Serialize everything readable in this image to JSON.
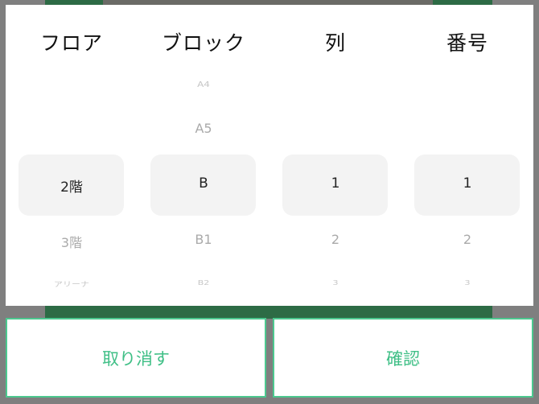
{
  "picker": {
    "columns": [
      {
        "header": "フロア",
        "above_far": "",
        "above_near": "",
        "selected": "2階",
        "below_near": "3階",
        "below_far": "アリーナ"
      },
      {
        "header": "ブロック",
        "above_far": "A4",
        "above_near": "A5",
        "selected": "B",
        "below_near": "B1",
        "below_far": "B2"
      },
      {
        "header": "列",
        "above_far": "",
        "above_near": "",
        "selected": "1",
        "below_near": "2",
        "below_far": "3"
      },
      {
        "header": "番号",
        "above_far": "",
        "above_near": "",
        "selected": "1",
        "below_near": "2",
        "below_far": "3"
      }
    ]
  },
  "actions": {
    "cancel_label": "取り消す",
    "confirm_label": "確認"
  },
  "colors": {
    "accent": "#3fbf86",
    "overlay": "#7f7f7f",
    "background_green": "#2d6b45"
  }
}
